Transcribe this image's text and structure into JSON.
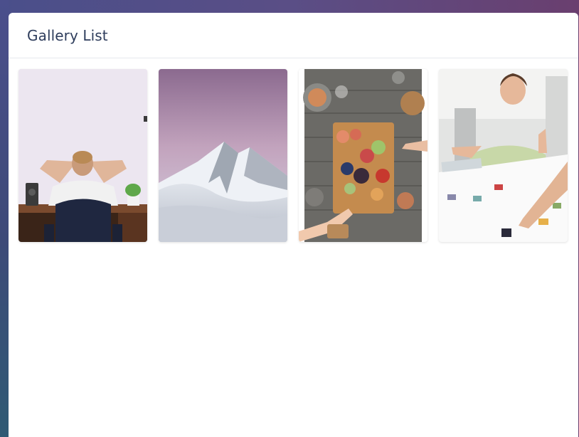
{
  "card": {
    "title": "Gallery List"
  },
  "gallery": {
    "items": [
      {
        "name": "person-relaxing-at-desk-photo"
      },
      {
        "name": "snowy-mountain-peak-photo"
      },
      {
        "name": "food-platter-table-photo"
      },
      {
        "name": "woman-laughing-at-table-photo"
      }
    ]
  },
  "colors": {
    "title_text": "#2e3d5c",
    "card_bg": "#ffffff",
    "header_border": "#e6e8ee"
  }
}
